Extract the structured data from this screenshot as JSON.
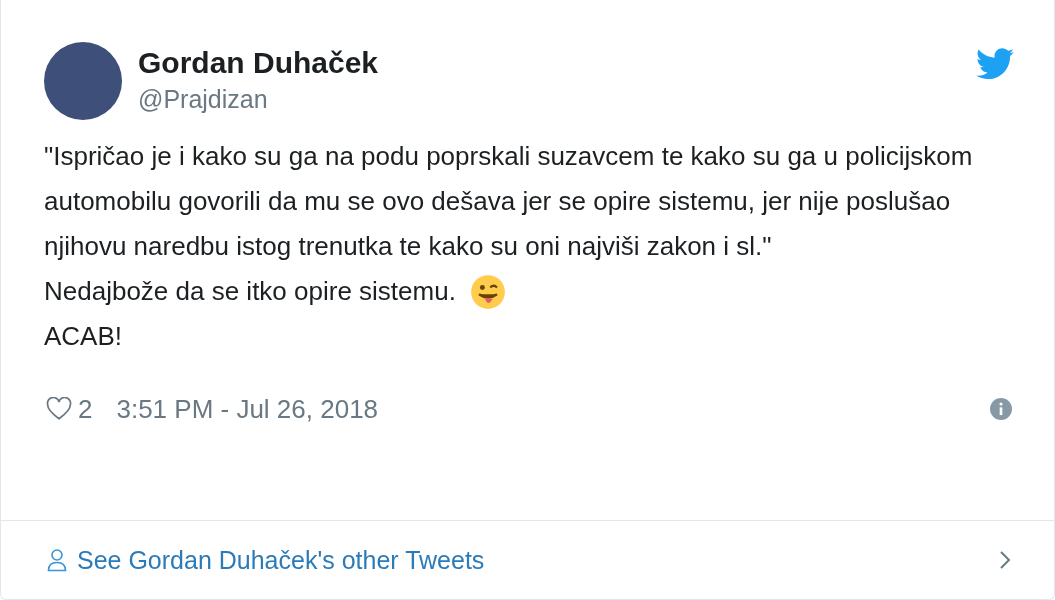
{
  "author": {
    "name": "Gordan Duhaček",
    "handle": "@Prajdizan"
  },
  "tweet": {
    "quote": "\"Ispričao je i kako su ga na podu poprskali suzavcem te kako su ga u policijskom automobilu govorili da mu se ovo dešava jer se opire sistemu, jer nije poslušao njihovu naredbu istog trenutka te kako su oni najviši zakon i sl.\"",
    "comment": "Nedajbože da se itko opire sistemu.",
    "closing": "ACAB!"
  },
  "footer": {
    "likes": "2",
    "time": "3:51 PM - Jul 26, 2018"
  },
  "more_link": "See Gordan Duhaček's other Tweets"
}
